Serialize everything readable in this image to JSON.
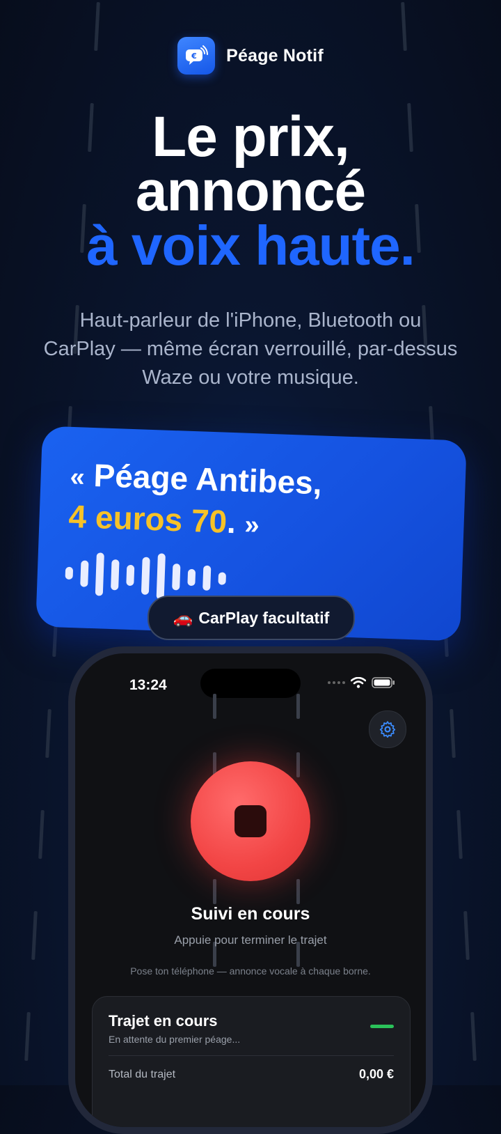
{
  "app": {
    "name": "Péage Notif",
    "icon": "message-euro-icon"
  },
  "headline": {
    "line1": "Le prix,",
    "line2": "annoncé",
    "line3": "à voix haute."
  },
  "subtitle": "Haut-parleur de l'iPhone, Bluetooth ou CarPlay — même écran verrouillé, par-dessus Waze ou votre musique.",
  "quote_card": {
    "open_quote": "«",
    "text_line1": "Péage Antibes,",
    "price": "4 euros 70",
    "text_end": ".",
    "close_quote": "»"
  },
  "carplay_badge": {
    "emoji": "🚗",
    "label": "CarPlay facultatif"
  },
  "phone": {
    "status_time": "13:24",
    "title": "Suivi en cours",
    "subtitle": "Appuie pour terminer le trajet",
    "hint": "Pose ton téléphone — annonce vocale à chaque borne.",
    "trip": {
      "title": "Trajet en cours",
      "subtitle": "En attente du premier péage...",
      "total_label": "Total du trajet",
      "total_value": "0,00 €"
    }
  },
  "colors": {
    "accent_blue": "#1f66ff",
    "price_yellow": "#f6c228",
    "stop_red": "#f24545",
    "ok_green": "#2bc25a"
  }
}
